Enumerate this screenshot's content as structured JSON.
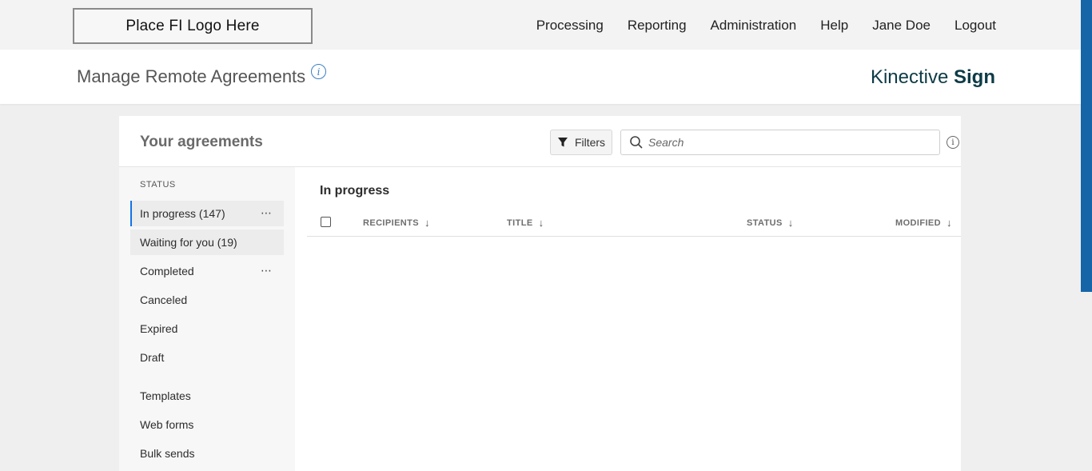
{
  "header": {
    "logo_text": "Place FI Logo Here",
    "nav": [
      "Processing",
      "Reporting",
      "Administration",
      "Help",
      "Jane Doe",
      "Logout"
    ]
  },
  "titlebar": {
    "page_title": "Manage Remote Agreements",
    "info_glyph": "i",
    "brand_light": "Kinective ",
    "brand_bold": "Sign"
  },
  "panel": {
    "title": "Your agreements",
    "filters_label": "Filters",
    "search_placeholder": "Search"
  },
  "sidebar": {
    "status_heading": "STATUS",
    "items": [
      {
        "label": "In progress (147)",
        "state": "active",
        "has_menu": true
      },
      {
        "label": "Waiting for you (19)",
        "state": "hover",
        "has_menu": false
      },
      {
        "label": "Completed",
        "state": "normal",
        "has_menu": true
      },
      {
        "label": "Canceled",
        "state": "normal",
        "has_menu": false
      },
      {
        "label": "Expired",
        "state": "normal",
        "has_menu": false
      },
      {
        "label": "Draft",
        "state": "normal",
        "has_menu": false
      },
      {
        "label": "Templates",
        "state": "normal",
        "has_menu": false
      },
      {
        "label": "Web forms",
        "state": "normal",
        "has_menu": false
      },
      {
        "label": "Bulk sends",
        "state": "normal",
        "has_menu": false
      }
    ],
    "menu_glyph": "⋯"
  },
  "content": {
    "section_title": "In progress",
    "columns": [
      "RECIPIENTS",
      "TITLE",
      "STATUS",
      "MODIFIED"
    ],
    "sort_glyph": "↓"
  },
  "colors": {
    "accent_blue": "#1473e6",
    "scrollbar": "#1565a8",
    "brand": "#0d3b46"
  }
}
